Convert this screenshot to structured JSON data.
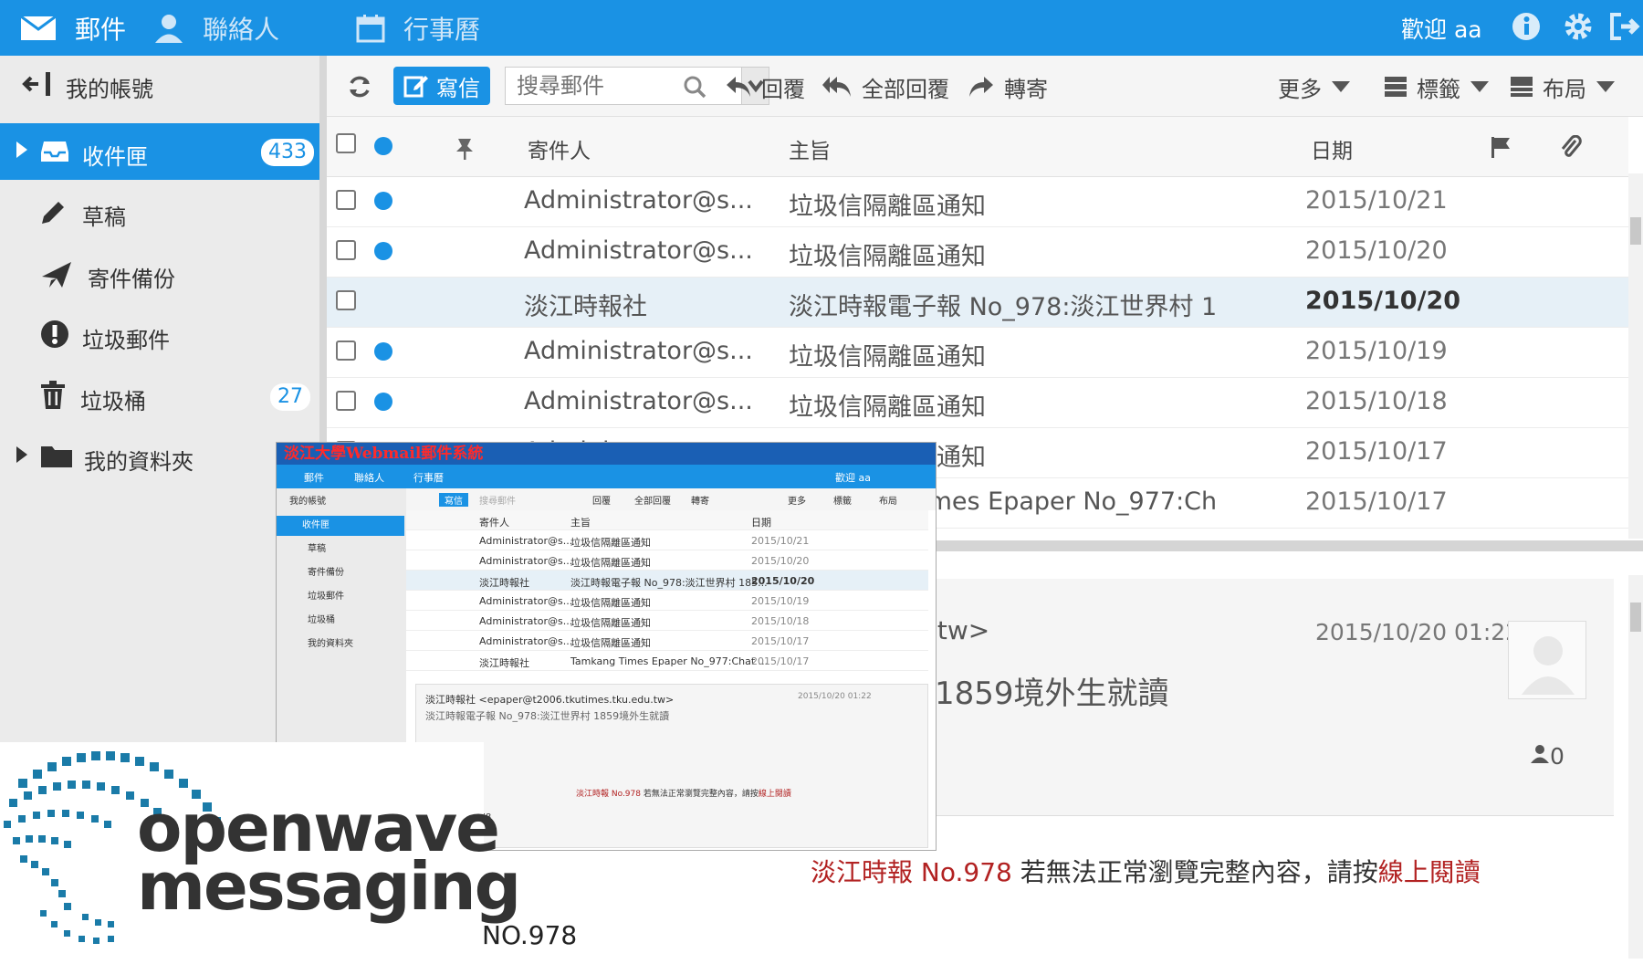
{
  "topbar": {
    "mail": "郵件",
    "contacts": "聯絡人",
    "calendar": "行事曆",
    "welcome": "歡迎 aa"
  },
  "sidebar": {
    "account": "我的帳號",
    "items": [
      {
        "label": "收件匣",
        "badge": "433",
        "icon": "inbox-icon"
      },
      {
        "label": "草稿",
        "icon": "pencil-icon"
      },
      {
        "label": "寄件備份",
        "icon": "send-icon"
      },
      {
        "label": "垃圾郵件",
        "icon": "alert-icon"
      },
      {
        "label": "垃圾桶",
        "badge": "27",
        "icon": "trash-icon"
      },
      {
        "label": "我的資料夾",
        "icon": "folder-icon"
      }
    ]
  },
  "toolbar": {
    "compose": "寫信",
    "search_placeholder": "搜尋郵件",
    "reply": "回覆",
    "reply_all": "全部回覆",
    "forward": "轉寄",
    "more": "更多",
    "tags": "標籤",
    "layout": "布局"
  },
  "table": {
    "headers": {
      "from": "寄件人",
      "subject": "主旨",
      "date": "日期"
    },
    "rows": [
      {
        "from": "Administrator@s...",
        "subject": "垃圾信隔離區通知",
        "date": "2015/10/21",
        "unread": true
      },
      {
        "from": "Administrator@s...",
        "subject": "垃圾信隔離區通知",
        "date": "2015/10/20",
        "unread": true
      },
      {
        "from": "淡江時報社",
        "subject": "淡江時報電子報 No_978:淡江世界村 185...",
        "date": "2015/10/20",
        "unread": false,
        "selected": true
      },
      {
        "from": "Administrator@s...",
        "subject": "垃圾信隔離區通知",
        "date": "2015/10/19",
        "unread": true
      },
      {
        "from": "Administrator@s...",
        "subject": "垃圾信隔離區通知",
        "date": "2015/10/18",
        "unread": true
      },
      {
        "from": "Administrator@s...",
        "subject": "垃圾信隔離區通知",
        "date": "2015/10/17",
        "unread": true
      },
      {
        "from": "淡江時報社",
        "subject": "Tamkang Times Epaper No_977:Chat ...",
        "date": "2015/10/17",
        "unread": true
      }
    ]
  },
  "preview": {
    "sender": "淡江時報社 <epaper@t2006.tkutimes.tku.edu.tw>",
    "sender_visible": ".tw>",
    "date": "2015/10/20 01:22",
    "subject": "淡江時報電子報 No_978:淡江世界村 1859境外生就讀",
    "subject_visible": "1859境外生就讀",
    "recipients_count": "0",
    "notice_prefix": "淡江時報 No.978",
    "notice_middle": " 若無法正常瀏覽完整內容，請按",
    "notice_link": "線上閱讀",
    "issue": "NO.978"
  },
  "mini": {
    "caption": "淡江大學Webmail郵件系統",
    "issue": ".978"
  },
  "logo": {
    "line1": "openwave",
    "line2": "messaging"
  },
  "colors": {
    "accent": "#1a92e4",
    "sidebar_bg": "#ebebeb",
    "notice_red": "#b22222"
  }
}
